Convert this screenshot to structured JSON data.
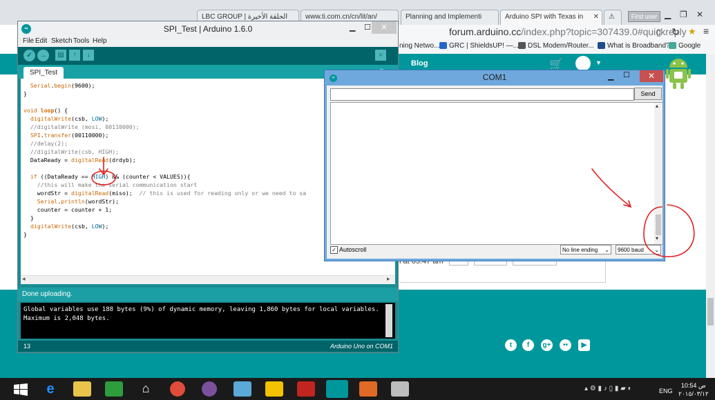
{
  "browser": {
    "tabs": [
      {
        "label": "LBC GROUP | الحلقة الأخيرة"
      },
      {
        "label": "www.ti.com.cn/cn/lit/an/"
      },
      {
        "label": "Planning and Implementi"
      },
      {
        "label": "Arduino SPI with Texas in"
      }
    ],
    "user_button": "First user",
    "url_domain": "forum.arduino.cc",
    "url_path": "/index.php?topic=307439.0#quickreply",
    "bookmarks": [
      {
        "label": "ning Netwo..."
      },
      {
        "label": "GRC | ShieldsUP! —..."
      },
      {
        "label": "DSL Modem/Router..."
      },
      {
        "label": "What is Broadband?"
      },
      {
        "label": "Google"
      }
    ],
    "site_nav_blog": "Blog",
    "site_form_text": "l at 05:47 am"
  },
  "ide": {
    "title": "SPI_Test | Arduino 1.6.0",
    "menu": [
      "File",
      "Edit",
      "Sketch",
      "Tools",
      "Help"
    ],
    "tab_label": "SPI_Test",
    "code_lines": {
      "l1_a": "  ",
      "l1_kw": "Serial",
      "l1_b": ".",
      "l1_kw2": "begin",
      "l1_c": "(9600);",
      "l2": "}",
      "l3_kw": "void",
      "l3_a": " ",
      "l3_kw2": "loop",
      "l3_b": "() {",
      "l4_kw": "digitalWrite",
      "l4_a": "(csb, ",
      "l4_c": "LOW",
      "l4_b": ");",
      "l5": "  //digitalWrite (mosi, 00110000);",
      "l6_kw": "SPI",
      "l6_a": ".",
      "l6_kw2": "transfer",
      "l6_b": "(00110000);",
      "l7": "  //delay(2);",
      "l8": "  //digitalWrite(csb, HIGH);",
      "l9_a": "  DataReady = ",
      "l9_kw": "digitalRead",
      "l9_b": "(drdyb);",
      "l10_a": "  ",
      "l10_kw": "if",
      "l10_b": " ((DataReady == ",
      "l10_c": "HIGH",
      "l10_d": ") && (counter < VALUES)){",
      "l11": "    //this will make the serial communication start",
      "l12_a": "    wordStr = ",
      "l12_kw": "digitalRead",
      "l12_b": "(miso);  ",
      "l12_cmt": "// this is used for reading only or we need to sa",
      "l13_a": "    ",
      "l13_kw": "Serial",
      "l13_b": ".",
      "l13_kw2": "println",
      "l13_c": "(wordStr);",
      "l14": "    counter = counter + 1;",
      "l15": "  }",
      "l16_kw": "digitalWrite",
      "l16_a": "(csb, ",
      "l16_c": "LOW",
      "l16_b": ");",
      "l17": "}"
    },
    "status": "Done uploading.",
    "console_line1": "Global variables use 188 bytes (9%) of dynamic memory, leaving 1,860 bytes for local variables.",
    "console_line2": "Maximum is 2,048 bytes.",
    "footer_line": "13",
    "footer_board": "Arduino Uno on COM1"
  },
  "com": {
    "title": "COM1",
    "send_label": "Send",
    "input_value": "",
    "autoscroll_label": "Autoscroll",
    "line_ending": "No line ending",
    "baud": "9600 baud"
  },
  "taskbar": {
    "lang": "ENG",
    "time": "10:54 ص",
    "date": "٢٠١٥/٠٣/١٢"
  },
  "colors": {
    "arduino_teal": "#00979c",
    "arduino_dark": "#006468",
    "annotation_red": "#e02020"
  }
}
